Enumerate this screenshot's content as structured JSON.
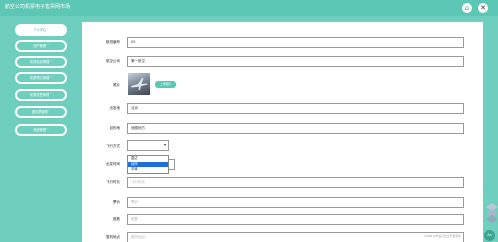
{
  "app": {
    "title": "航空公司机票电子售票网市场"
  },
  "top_icons": {
    "home": "⌂",
    "close": "✕"
  },
  "sidebar": {
    "items": [
      {
        "label": "个人中心 ˇ"
      },
      {
        "label": "用户管理 ˇ"
      },
      {
        "label": "机场信息管理 ˇ"
      },
      {
        "label": "机票预订管理 ˇ"
      },
      {
        "label": "机票改签管理 ˇ"
      },
      {
        "label": "退机票管理 ˇ"
      },
      {
        "label": "系统管理 ˇ"
      }
    ]
  },
  "form": {
    "flight_no": {
      "label": "航班编号",
      "value": "05"
    },
    "airline": {
      "label": "航空公司",
      "value": "第一航空"
    },
    "photo": {
      "label": "照片",
      "upload_label": "上传图片"
    },
    "departure": {
      "label": "出发地",
      "value": "北京"
    },
    "destination": {
      "label": "目的地",
      "value": "地图地方"
    },
    "flight_type": {
      "label": "飞行方式"
    },
    "depart_time": {
      "label": "出发时间"
    },
    "duration": {
      "label": "飞行时长",
      "placeholder": "飞行时长"
    },
    "price": {
      "label": "票价",
      "placeholder": "票价"
    },
    "seats": {
      "label": "座数",
      "placeholder": "座数"
    },
    "boarding": {
      "label": "登机地点",
      "placeholder": "登机地点"
    }
  },
  "dropdown": {
    "options": [
      {
        "label": "直达"
      },
      {
        "label": "经停"
      },
      {
        "label": "中转"
      }
    ],
    "selected_index": 1
  },
  "fab": {
    "label": "Ah"
  },
  "watermark": "CSDN @毕设计论文开发源码"
}
